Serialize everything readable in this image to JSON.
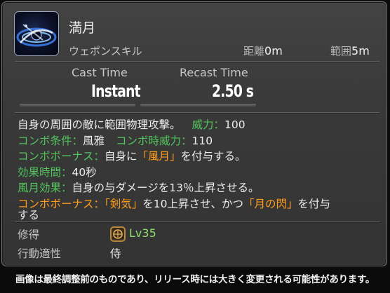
{
  "skill": {
    "name": "満月",
    "category": "ウェポンスキル",
    "distance_label": "距離",
    "distance_value": "0m",
    "range_label": "範囲",
    "range_value": "5m",
    "icon": "moon-skill-icon"
  },
  "timing": {
    "cast_label": "Cast Time",
    "cast_value": "Instant",
    "recast_label": "Recast Time",
    "recast_value": "2.50 s"
  },
  "description": {
    "line1_text": "自身の周囲の敵に範囲物理攻撃。",
    "line1_potency_label": "威力：",
    "line1_potency_value": "100",
    "line2_combo_cond_label": "コンボ条件：",
    "line2_combo_cond_value": "風雅",
    "line2_combo_potency_label": "コンボ時威力：",
    "line2_combo_potency_value": "110",
    "line3_bonus_label": "コンボボーナス：",
    "line3_pre": "自身に",
    "line3_effect": "「風月」",
    "line3_post": "を付与する。",
    "line4_duration_label": "効果時間：",
    "line4_duration_value": "40秒",
    "line5_effect_label": "風月効果：",
    "line5_effect_value": "自身の与ダメージを13％上昇させる。",
    "line6_bonus_label": "コンボボーナス：",
    "line6_kenki": "「剣気」",
    "line6_mid": "を10上昇させ、かつ",
    "line6_gekko": "「月の閃」",
    "line6_post": "を付与",
    "line7_text": "する"
  },
  "footer": {
    "acquired_label": "修得",
    "acquired_level": "Lv35",
    "acquired_icon": "class-emblem-icon",
    "affinity_label": "行動適性",
    "affinity_value": "侍"
  },
  "disclaimer": "画像は最終調整前のものであり、リリース時には大きく変更される可能性があります。",
  "colors": {
    "label_green": "#52c45c",
    "highlight_orange": "#ff9c1a",
    "level_green": "#8ee06e"
  }
}
